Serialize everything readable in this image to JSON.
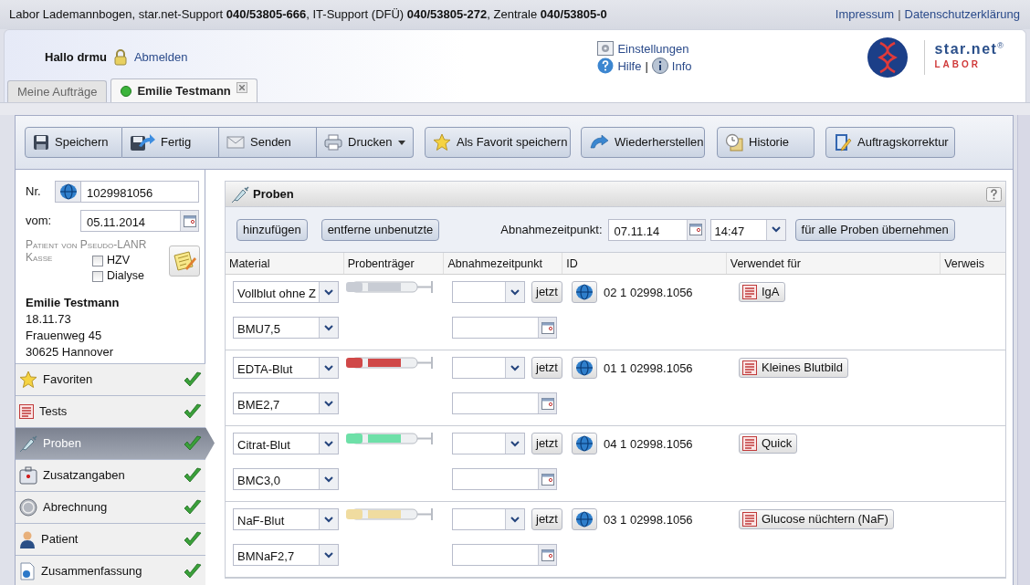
{
  "top_bar": {
    "info": "Labor Lademannbogen, star.net-Support **040/53805-666**, IT-Support (DFÜ) **040/53805-272**, Zentrale **040/53805-0**",
    "links": [
      "Impressum",
      "Datenschutzerklärung"
    ],
    "separator": "|"
  },
  "header": {
    "greeting": "Hallo drmu",
    "logout": "Abmelden",
    "settings": "Einstellungen",
    "help": "Hilfe",
    "info": "Info",
    "separator": "|",
    "logo": {
      "name": "star.net",
      "mark": "®",
      "sub": "LABOR"
    }
  },
  "tabs": [
    {
      "label": "Meine Aufträge",
      "kind": "home",
      "selected": false
    },
    {
      "label": "Emilie Testmann",
      "kind": "patient",
      "selected": true
    }
  ],
  "toolbar": {
    "group": [
      {
        "label": "Speichern",
        "dropdown": false
      },
      {
        "label": "Fertig",
        "dropdown": false
      },
      {
        "label": "Senden",
        "dropdown": false
      },
      {
        "label": "Drucken",
        "dropdown": true
      }
    ],
    "buttons": [
      "Als Favorit speichern",
      "Wiederherstellen",
      "Historie",
      "Auftragskorrektur"
    ]
  },
  "order": {
    "nr_label": "Nr.",
    "nr": "1029981056",
    "date_label": "vom:",
    "date": "05.11.2014",
    "patient_of": "Patient von Pseudo-LANR",
    "kasse": "Kasse",
    "checkboxes": [
      {
        "label": "HZV",
        "checked": false
      },
      {
        "label": "Dialyse",
        "checked": false
      }
    ]
  },
  "patient": {
    "name": "Emilie Testmann",
    "lines": [
      "18.11.73",
      "Frauenweg 45",
      "30625 Hannover"
    ]
  },
  "nav": [
    {
      "label": "Favoriten",
      "selected": false,
      "done": true
    },
    {
      "label": "Tests",
      "selected": false,
      "done": true
    },
    {
      "label": "Proben",
      "selected": true,
      "done": true
    },
    {
      "label": "Zusatzangaben",
      "selected": false,
      "done": true
    },
    {
      "label": "Abrechnung",
      "selected": false,
      "done": true
    },
    {
      "label": "Patient",
      "selected": false,
      "done": true
    },
    {
      "label": "Zusammenfassung",
      "selected": false,
      "done": true
    }
  ],
  "panel": {
    "title": "Proben",
    "add": "hinzufügen",
    "remove": "entferne unbenutzte",
    "time_label": "Abnahmezeitpunkt:",
    "date": "07.11.14",
    "time": "14:47",
    "apply": "für alle Proben übernehmen",
    "columns": [
      "Material",
      "Probenträger",
      "Abnahmezeitpunkt",
      "ID",
      "Verwendet für",
      "Verweis"
    ],
    "samples": [
      {
        "material": "Vollblut ohne Z",
        "container": "BMU7,5",
        "color": "#c8ccd4",
        "jetzt": "jetzt",
        "id": "02 1 02998.1056",
        "tests": [
          "IgA"
        ]
      },
      {
        "material": "EDTA-Blut",
        "container": "BME2,7",
        "color": "#d04848",
        "jetzt": "jetzt",
        "id": "01 1 02998.1056",
        "tests": [
          "Kleines Blutbild"
        ]
      },
      {
        "material": "Citrat-Blut",
        "container": "BMC3,0",
        "color": "#6ee0a8",
        "jetzt": "jetzt",
        "id": "04 1 02998.1056",
        "tests": [
          "Quick"
        ]
      },
      {
        "material": "NaF-Blut",
        "container": "BMNaF2,7",
        "color": "#f0dca0",
        "jetzt": "jetzt",
        "id": "03 1 02998.1056",
        "tests": [
          "Glucose nüchtern (NaF)"
        ]
      }
    ]
  }
}
